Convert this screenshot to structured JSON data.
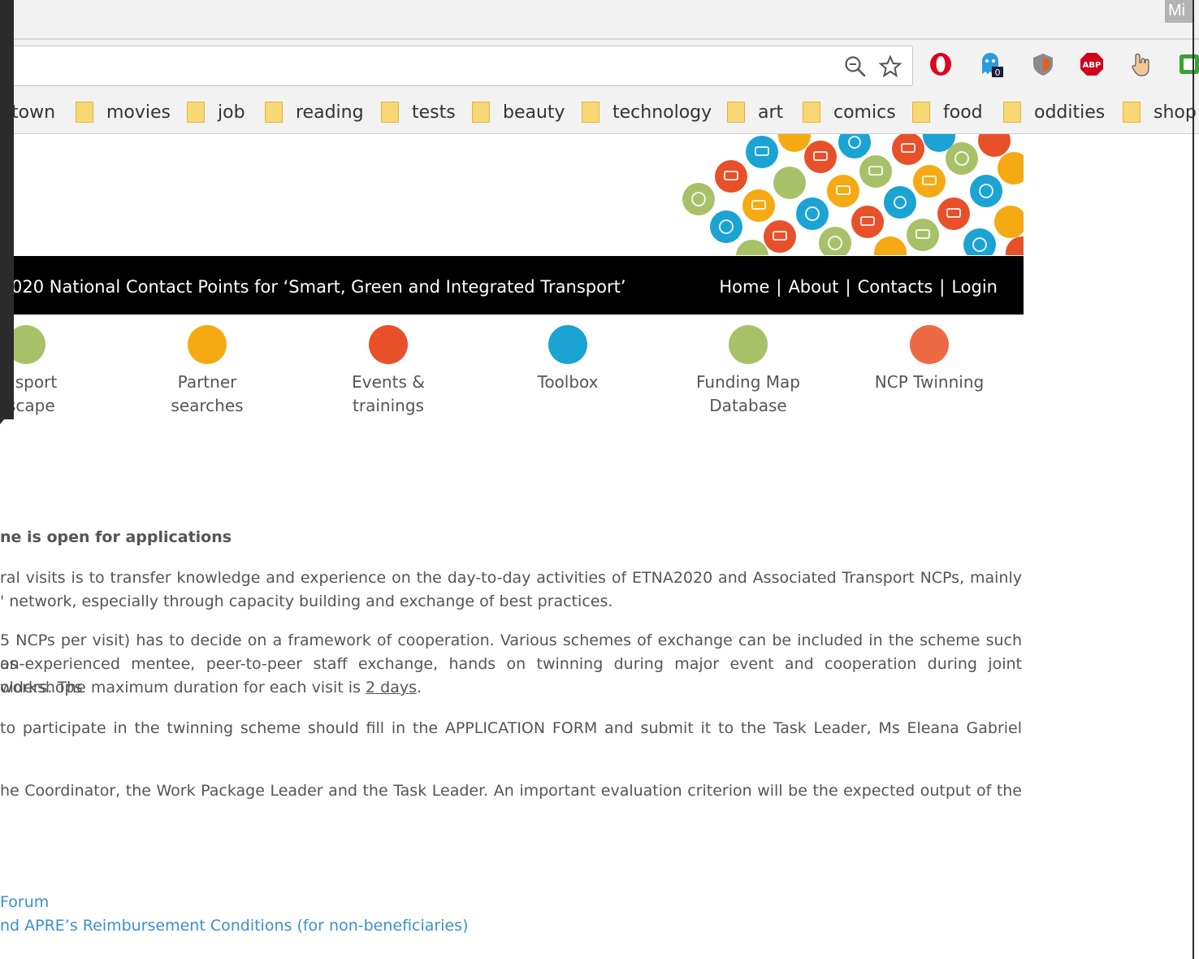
{
  "browser": {
    "corner_label": "Mi",
    "omnibox_icons": [
      "zoom-out-icon",
      "star-icon"
    ],
    "extensions": [
      {
        "name": "opera-icon",
        "color": "#e0001b"
      },
      {
        "name": "ghostery-icon",
        "badge": "0",
        "color": "#2d9be0"
      },
      {
        "name": "shield-extension-icon",
        "color": "#e06020"
      },
      {
        "name": "adblock-plus-icon",
        "label": "ABP",
        "color": "#d0021b"
      },
      {
        "name": "hand-pointer-icon",
        "color": "#555555"
      },
      {
        "name": "green-extension-icon",
        "color": "#3ca036"
      }
    ],
    "bookmarks": [
      "town",
      "movies",
      "job",
      "reading",
      "tests",
      "beauty",
      "technology",
      "art",
      "comics",
      "food",
      "oddities",
      "shop"
    ]
  },
  "site": {
    "nav_title": "020 National Contact Points for ‘Smart, Green and Integrated Transport’",
    "nav_links": [
      "Home",
      "About",
      "Contacts",
      "Login"
    ],
    "nav_separator": "|",
    "categories": [
      {
        "line1": "ansport",
        "line2": "dscape",
        "color": "#a8c169"
      },
      {
        "line1": "Partner",
        "line2": "searches",
        "color": "#f5aa13"
      },
      {
        "line1": "Events &",
        "line2": "trainings",
        "color": "#e8502a"
      },
      {
        "line1": "Toolbox",
        "line2": "",
        "color": "#1aa3d3"
      },
      {
        "line1": "Funding Map",
        "line2": "Database",
        "color": "#a8c169"
      },
      {
        "line1": "NCP Twinning",
        "line2": "",
        "color": "#ee6a45"
      }
    ]
  },
  "article": {
    "heading": "ne is open for applications",
    "p1_l1": "ral visits is to transfer knowledge and experience on the day-to-day activities of ETNA2020 and Associated Transport NCPs, mainly",
    "p1_l2": "' network, especially through capacity building and exchange of best practices.",
    "p2_l1": "5 NCPs per visit) has to decide on a framework of cooperation. Various schemes of exchange can be included in the scheme such as",
    "p2_l2": "on-experienced mentee, peer-to-peer staff exchange, hands on twinning during major event and cooperation during joint workshops",
    "p2_l3a": "olders. The maximum duration for each visit is ",
    "p2_l3b": "2 days",
    "p2_l3c": ".",
    "p3_l1": "to participate in the twinning scheme should fill in the APPLICATION FORM and submit it to the Task Leader, Ms Eleana Gabriel",
    "p4_l1": "he Coordinator, the Work Package Leader and the Task Leader. An important evaluation criterion will be the expected output of the",
    "links": [
      " Forum",
      "nd APRE’s Reimbursement Conditions (for non-beneficiaries)"
    ]
  }
}
